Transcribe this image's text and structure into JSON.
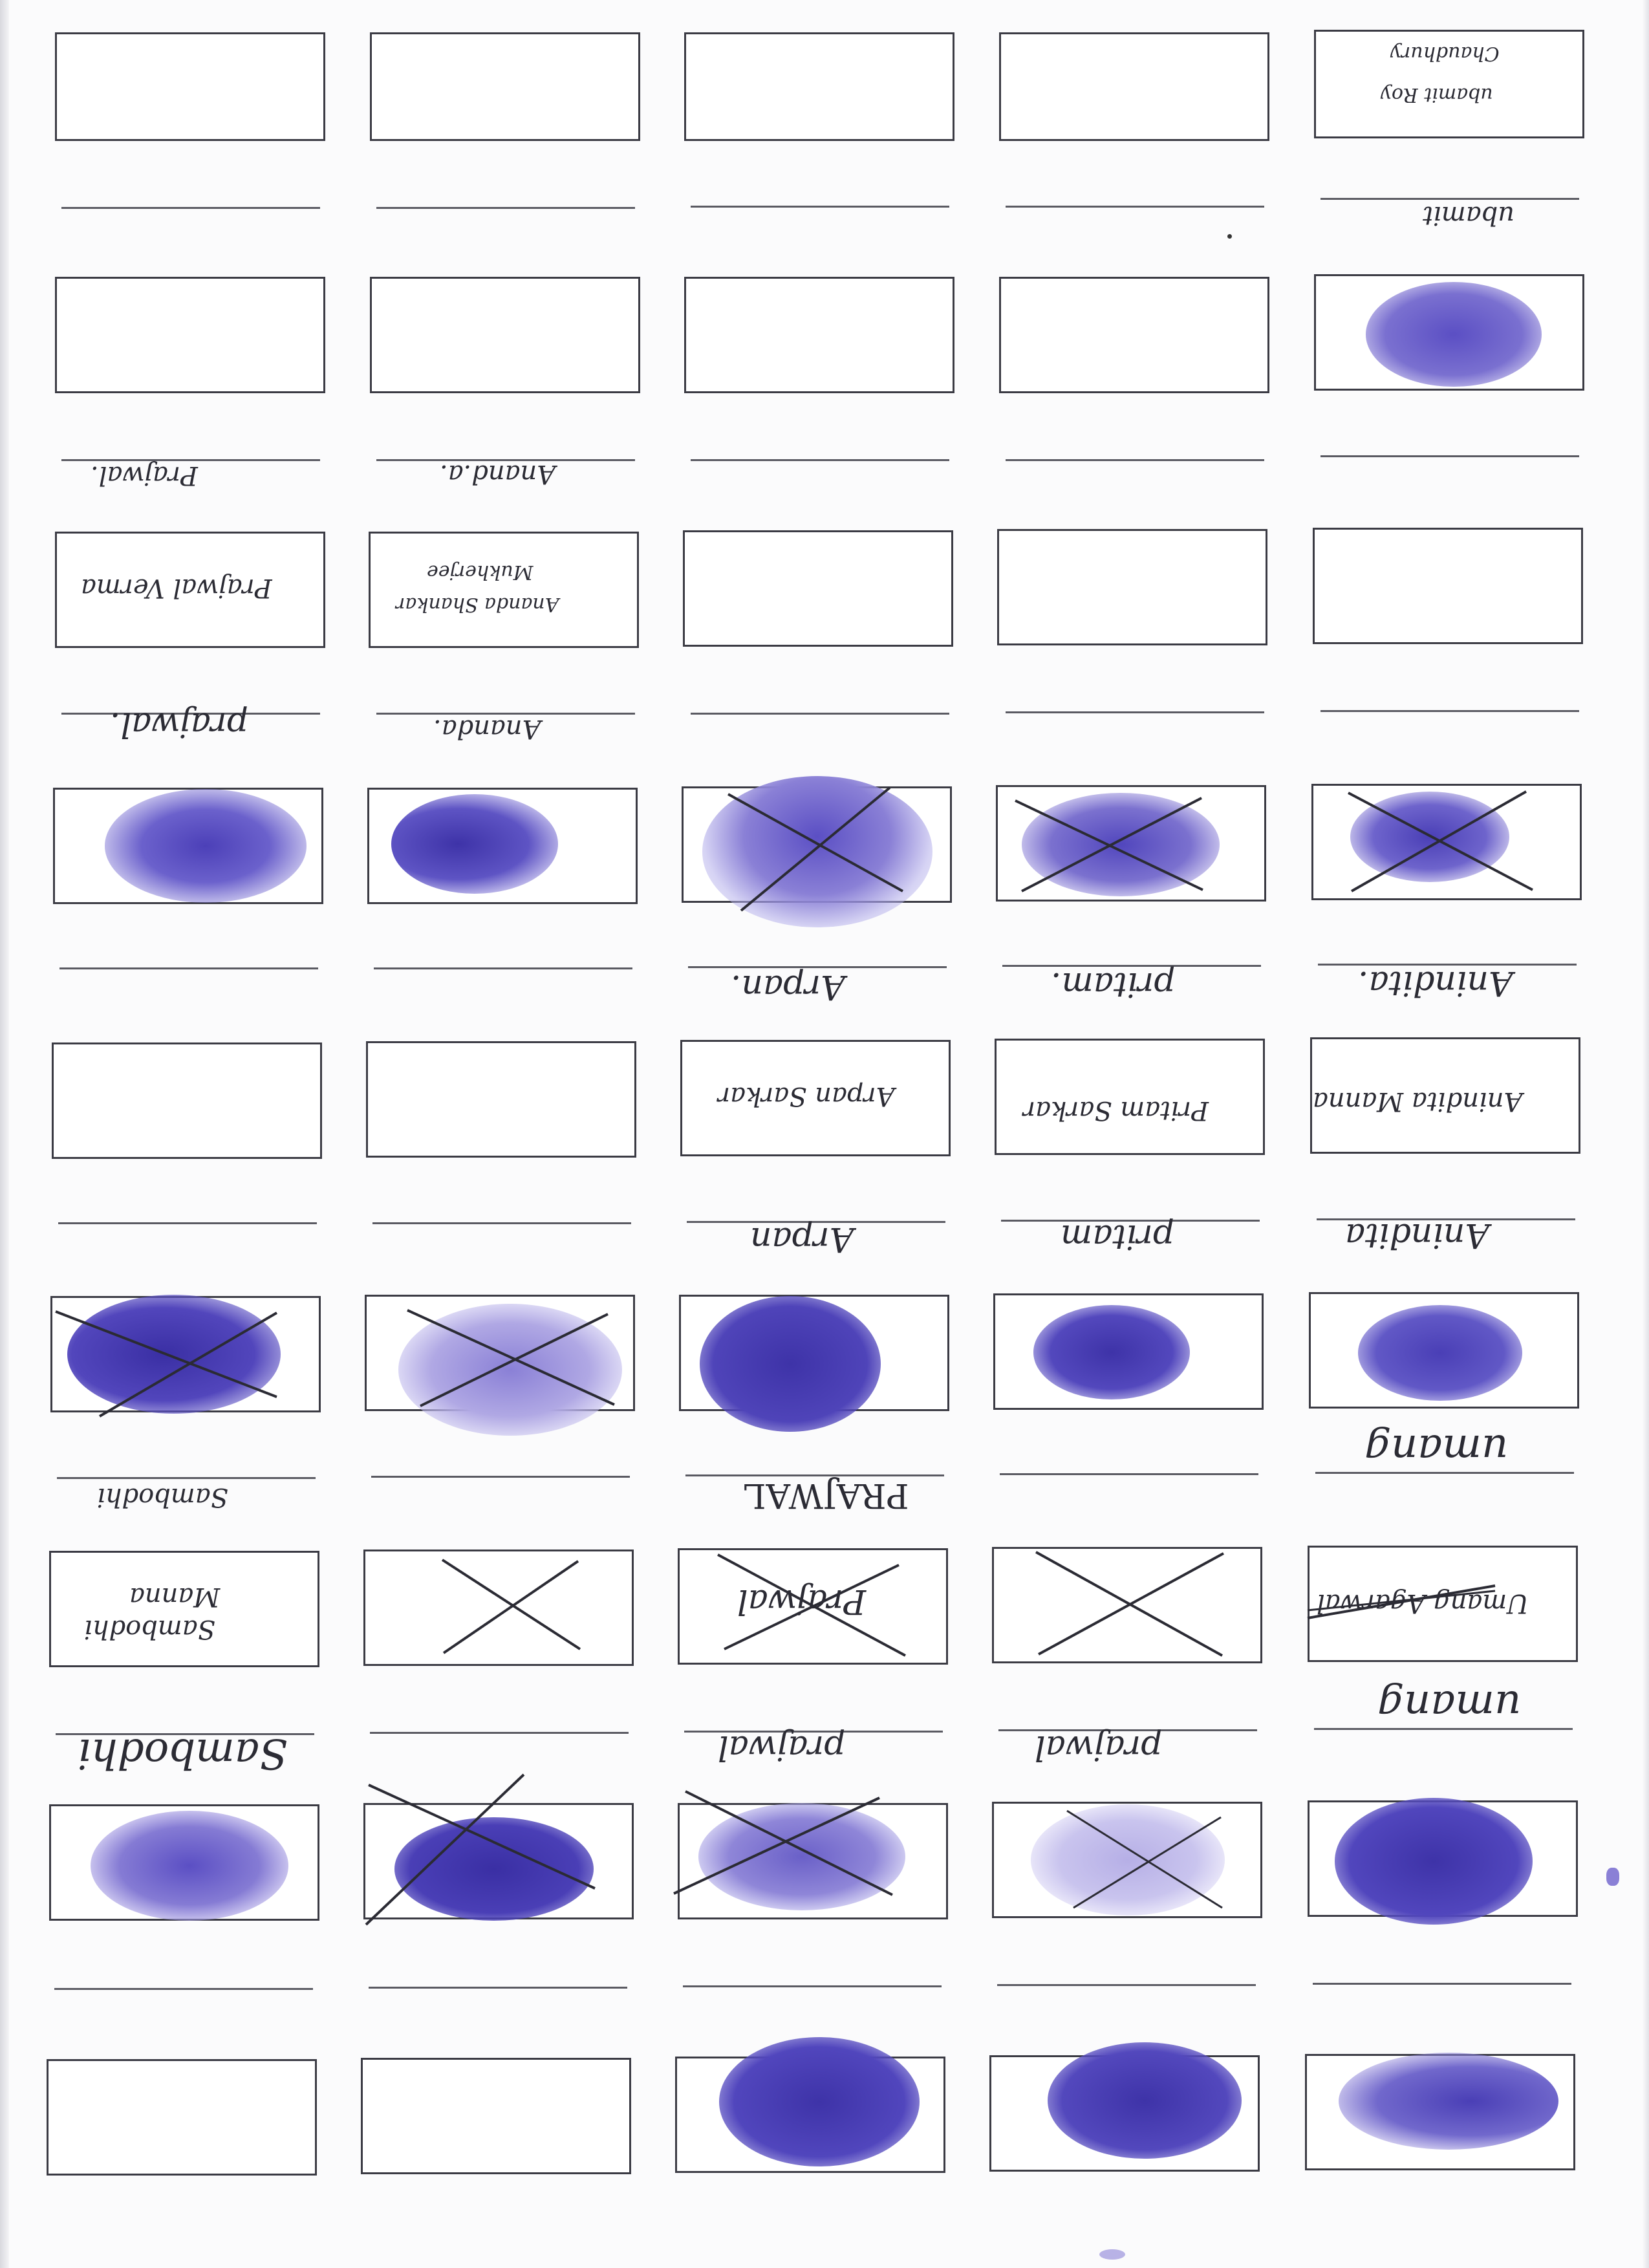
{
  "colors": {
    "ink": "#5b4fc4",
    "ink_dark": "#3e33a8",
    "paper": "#fbfbfc",
    "frame": "#3b3b44"
  },
  "grid": {
    "columns": 5,
    "row_types": [
      "box",
      "line",
      "box",
      "line",
      "box",
      "line",
      "box",
      "line",
      "box",
      "line",
      "box",
      "line",
      "box",
      "line",
      "box",
      "line",
      "box"
    ]
  },
  "signatures": {
    "r0_c5_a": "ubamit Roy",
    "r0_c5_b": "Chaudhury",
    "l1_c5": "ubamit",
    "l3_c1": "Prajwal.",
    "l3_c2": "Anand.a.",
    "b4_c1": "Prajwal Verma",
    "b4_c2_a": "Ananda Shankar",
    "b4_c2_b": "Mukherjee",
    "l5_c1": "prajwal.",
    "l5_c2": "Ananda.",
    "l7_c3": "Arpan.",
    "l7_c4": "pritam.",
    "l7_c5": "Anindita.",
    "b8_c3": "Arpan Sarkar",
    "b8_c4": "Pritam Sarkar",
    "b8_c5": "Anindita Manna",
    "l9_c3": "Arpan",
    "l9_c4": "pritam",
    "l9_c5": "Anindita",
    "l11_c1": "Sambodhi",
    "l11_c3": "PRAJWAL",
    "l11_c5": "umang",
    "b12_c1_a": "Sambodhi",
    "b12_c1_b": "Manna",
    "b12_c3": "Prajwal",
    "b12_c5": "Umang Agarwal",
    "l13_c1": "Sambodhi",
    "l13_c3": "prajwal",
    "l13_c4": "prajwal",
    "l13_c5": "umang"
  }
}
